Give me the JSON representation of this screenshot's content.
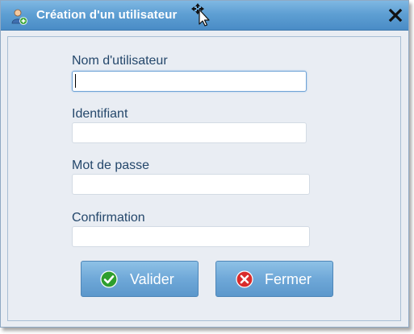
{
  "window": {
    "title": "Création d'un utilisateur",
    "icons": {
      "title": "user-add-icon",
      "close": "close-icon"
    }
  },
  "form": {
    "fields": [
      {
        "label": "Nom d'utilisateur",
        "value": "",
        "focused": true
      },
      {
        "label": "Identifiant",
        "value": ""
      },
      {
        "label": "Mot de passe",
        "value": ""
      },
      {
        "label": "Confirmation",
        "value": ""
      }
    ]
  },
  "buttons": {
    "validate": {
      "label": "Valider",
      "icon": "check-circle-icon",
      "icon_color": "#2e9e2e"
    },
    "close": {
      "label": "Fermer",
      "icon": "x-circle-icon",
      "icon_color": "#d92b2b"
    }
  },
  "colors": {
    "title_bar": "#5e9fd3",
    "button": "#6fa8d8",
    "label_text": "#24476b",
    "window_bg": "#e9edf3"
  }
}
